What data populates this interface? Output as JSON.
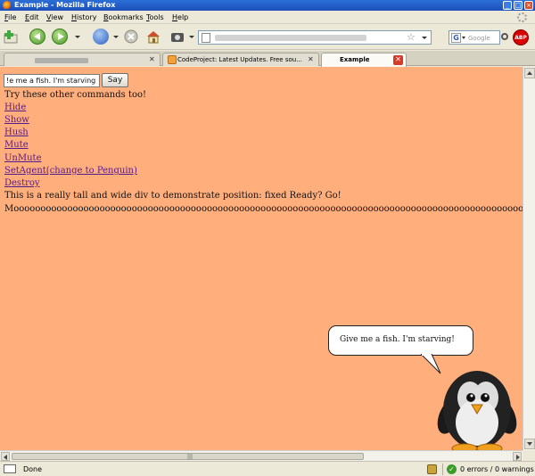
{
  "window": {
    "title": "Example - Mozilla Firefox",
    "buttons": {
      "minimize": "_",
      "maximize": "□",
      "close": "×"
    }
  },
  "menu": [
    "File",
    "Edit",
    "View",
    "History",
    "Bookmarks",
    "Tools",
    "Help"
  ],
  "toolbar": {
    "icons": [
      "add-icon",
      "back-icon",
      "forward-icon",
      "reload-icon",
      "stop-icon",
      "home-icon",
      "screenshot-icon"
    ]
  },
  "search": {
    "engine": "G",
    "placeholder": "Google"
  },
  "abp": {
    "label": "ABP"
  },
  "tabs": [
    {
      "label": ""
    },
    {
      "label": "CodeProject: Latest Updates. Free sou..."
    },
    {
      "label": "Example"
    }
  ],
  "page": {
    "input_value": "e me a fish.  I'm starving!",
    "say_button": "Say",
    "intro": "Try these other commands too!",
    "links": [
      "Hide",
      "Show",
      "Hush",
      "Mute",
      "UnMute",
      "SetAgent(change to Penguin)",
      "Destroy"
    ],
    "tall_div": "This is a really tall and wide div to demonstrate position: fixed Ready? Go!",
    "moo": "Mooooooooooooooooooooooooooooooooooooooooooooooooooooooooooooooooooooooooooooooooooooooooooooooooooooooooooooooooooooooooooooooooo",
    "bubble_text": "Give me a fish.  I'm starving!"
  },
  "scroll": {
    "grip": "|||"
  },
  "status": {
    "text": "Done",
    "errors": "0 errors / 0 warnings",
    "ok_mark": "✓"
  },
  "colors": {
    "page_background": "#ffae7c",
    "link": "#551a8b",
    "titlebar": "#2b6fd6"
  }
}
